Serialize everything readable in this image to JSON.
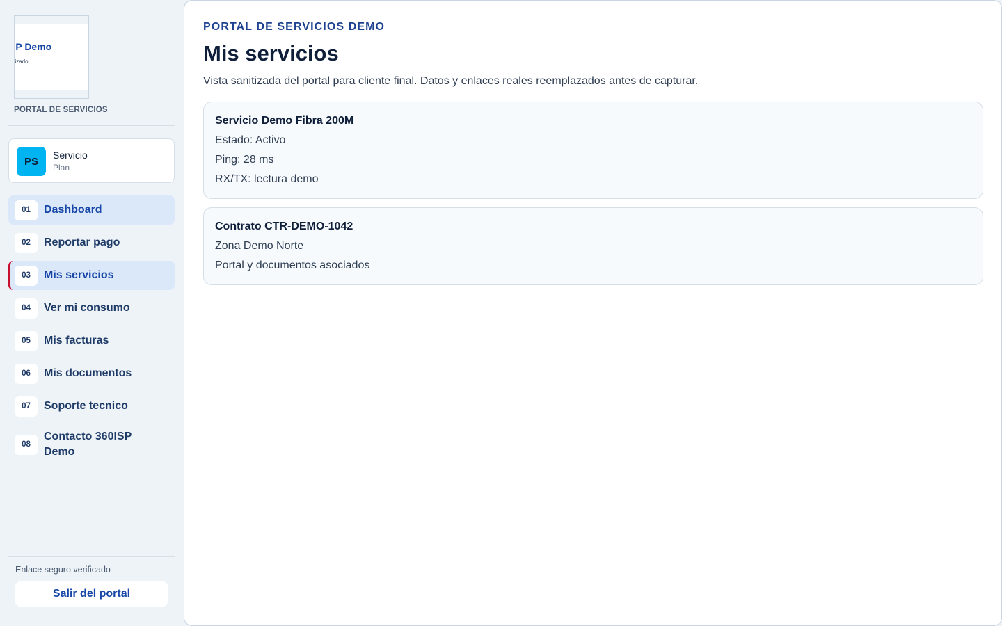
{
  "sidebar": {
    "logo": {
      "title": "SP Demo",
      "subtitle": "nitizado"
    },
    "portal_label": "PORTAL DE SERVICIOS",
    "service_card": {
      "initials": "PS",
      "name": "Servicio",
      "plan": "Plan"
    },
    "nav": [
      {
        "num": "01",
        "label": "Dashboard"
      },
      {
        "num": "02",
        "label": "Reportar pago"
      },
      {
        "num": "03",
        "label": "Mis servicios"
      },
      {
        "num": "04",
        "label": "Ver mi consumo"
      },
      {
        "num": "05",
        "label": "Mis facturas"
      },
      {
        "num": "06",
        "label": "Mis documentos"
      },
      {
        "num": "07",
        "label": "Soporte tecnico"
      },
      {
        "num": "08",
        "label": "Contacto 360ISP Demo"
      }
    ],
    "secure_text": "Enlace seguro verificado",
    "logout_label": "Salir del portal"
  },
  "main": {
    "eyebrow": "PORTAL DE SERVICIOS DEMO",
    "title": "Mis servicios",
    "description": "Vista sanitizada del portal para cliente final. Datos y enlaces reales reemplazados antes de capturar.",
    "cards": [
      {
        "title": "Servicio Demo Fibra 200M",
        "lines": [
          "Estado: Activo",
          "Ping: 28 ms",
          "RX/TX: lectura demo"
        ]
      },
      {
        "title": "Contrato CTR-DEMO-1042",
        "lines": [
          "Zona Demo Norte",
          "Portal y documentos asociados"
        ]
      }
    ]
  },
  "colors": {
    "accent": "#1747a6",
    "active_bg": "#dbe8fa",
    "current_marker": "#c8102e",
    "avatar_bg": "#00b4f2"
  }
}
